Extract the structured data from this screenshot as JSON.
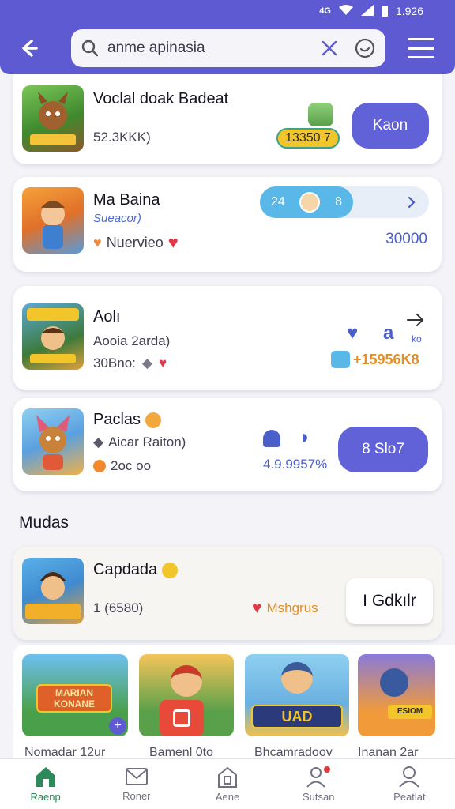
{
  "status": {
    "time": "1.926"
  },
  "search": {
    "query": "anme apinasia"
  },
  "apps": [
    {
      "title": "Voclal doak Badeat",
      "line1": "52.3KKK)",
      "badge": "13350 7",
      "button": "Kaon"
    },
    {
      "title": "Ma Baina",
      "line1": "Sueacor)",
      "line2": "Nuervieo",
      "pill_left": "24",
      "pill_right": "8",
      "value": "30000"
    },
    {
      "title": "Aolı",
      "line1": "Aooia 2arda)",
      "line2": "30Bno:",
      "stat1": "a",
      "stat2": "ko",
      "value": "+15956K8"
    },
    {
      "title": "Paclas",
      "line1": "Aicar Raiton)",
      "line2": "2oc oo",
      "value": "4.9.9957%",
      "button": "8 Slo7"
    }
  ],
  "section": {
    "title": "Mudas"
  },
  "featured": {
    "title": "Capdada",
    "line1": "1 (6580)",
    "tag": "Mshgrus",
    "button": "I Gdkılr"
  },
  "carousel": [
    {
      "label": "Nomadar 12ur",
      "thumb_text": "MARIAN KONANE"
    },
    {
      "label": "Bamenl 0to",
      "thumb_text": ""
    },
    {
      "label": "Bhcamradoov",
      "thumb_text": "UAD"
    },
    {
      "label": "Inanan 2ar",
      "thumb_text": "ESIOM"
    }
  ],
  "nav": [
    {
      "label": "Raenp",
      "icon": "home-icon"
    },
    {
      "label": "Roner",
      "icon": "mail-icon"
    },
    {
      "label": "Aene",
      "icon": "store-icon"
    },
    {
      "label": "Sutsan",
      "icon": "users-icon"
    },
    {
      "label": "Peatlat",
      "icon": "profile-icon"
    }
  ],
  "colors": {
    "accent": "#5e5ad2",
    "active_nav": "#2c8a5a",
    "value_blue": "#4a5fc8",
    "badge_yellow": "#f2c62a"
  }
}
